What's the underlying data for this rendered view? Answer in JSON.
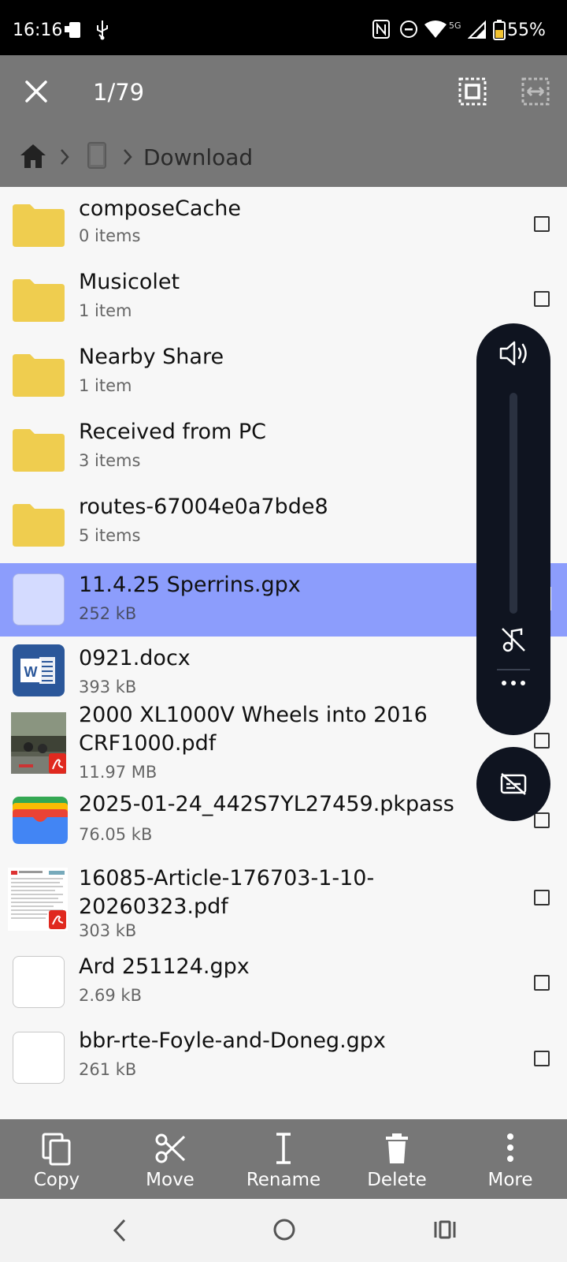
{
  "status_bar": {
    "time": "16:16",
    "network": "5G",
    "battery": "55%"
  },
  "action_bar": {
    "counter": "1/79",
    "close_icon": "close-icon",
    "select_all_icon": "select-all-icon",
    "select_range_icon": "select-range-icon"
  },
  "breadcrumb": {
    "folder": "Download"
  },
  "files": [
    {
      "name": "composeCache",
      "meta": "0 items",
      "type": "folder"
    },
    {
      "name": "Musicolet",
      "meta": "1 item",
      "type": "folder"
    },
    {
      "name": "Nearby Share",
      "meta": "1 item",
      "type": "folder"
    },
    {
      "name": "Received from PC",
      "meta": "3 items",
      "type": "folder"
    },
    {
      "name": "routes-67004e0a7bde8",
      "meta": "5 items",
      "type": "folder"
    },
    {
      "name": "11.4.25 Sperrins.gpx",
      "meta": "252 kB",
      "type": "gpx",
      "selected": true
    },
    {
      "name": "0921.docx",
      "meta": "393 kB",
      "type": "docx"
    },
    {
      "name": "2000 XL1000V Wheels into 2016 CRF1000.pdf",
      "meta": "11.97 MB",
      "type": "pdf-photo"
    },
    {
      "name": "2025-01-24_442S7YL27459.pkpass",
      "meta": "76.05 kB",
      "type": "pkpass"
    },
    {
      "name": "16085-Article-176703-1-10-20260323.pdf",
      "meta": "303 kB",
      "type": "pdf-doc"
    },
    {
      "name": "Ard 251124.gpx",
      "meta": "2.69 kB",
      "type": "gpx"
    },
    {
      "name": "bbr-rte-Foyle-and-Doneg.gpx",
      "meta": "261 kB",
      "type": "gpx"
    }
  ],
  "toolbar": {
    "copy": "Copy",
    "move": "Move",
    "rename": "Rename",
    "delete": "Delete",
    "more": "More"
  },
  "colors": {
    "bar": "#777777",
    "selected": "#8c9dfc",
    "folder": "#efcd4f",
    "volume_panel": "#0f1420"
  }
}
